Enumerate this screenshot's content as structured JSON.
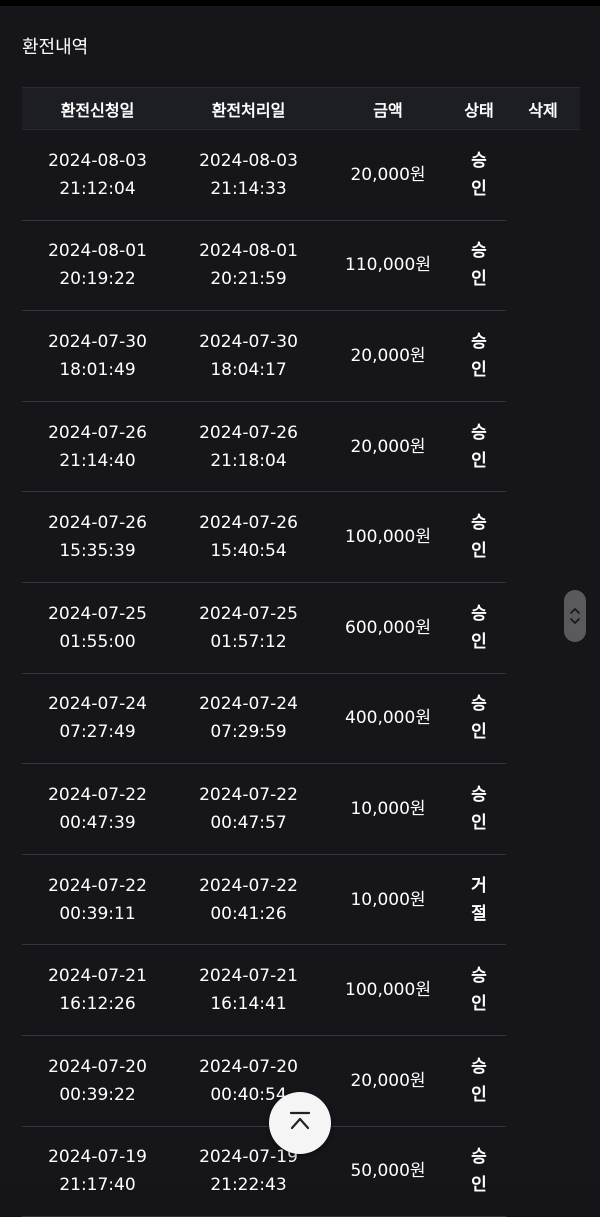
{
  "page": {
    "title": "환전내역"
  },
  "table": {
    "headers": {
      "request_date": "환전신청일",
      "processed_date": "환전처리일",
      "amount": "금액",
      "status": "상태",
      "delete": "삭제"
    },
    "rows": [
      {
        "req_date": "2024-08-03",
        "req_time": "21:12:04",
        "proc_date": "2024-08-03",
        "proc_time": "21:14:33",
        "amount": "20,000원",
        "status_1": "승",
        "status_2": "인"
      },
      {
        "req_date": "2024-08-01",
        "req_time": "20:19:22",
        "proc_date": "2024-08-01",
        "proc_time": "20:21:59",
        "amount": "110,000원",
        "status_1": "승",
        "status_2": "인"
      },
      {
        "req_date": "2024-07-30",
        "req_time": "18:01:49",
        "proc_date": "2024-07-30",
        "proc_time": "18:04:17",
        "amount": "20,000원",
        "status_1": "승",
        "status_2": "인"
      },
      {
        "req_date": "2024-07-26",
        "req_time": "21:14:40",
        "proc_date": "2024-07-26",
        "proc_time": "21:18:04",
        "amount": "20,000원",
        "status_1": "승",
        "status_2": "인"
      },
      {
        "req_date": "2024-07-26",
        "req_time": "15:35:39",
        "proc_date": "2024-07-26",
        "proc_time": "15:40:54",
        "amount": "100,000원",
        "status_1": "승",
        "status_2": "인"
      },
      {
        "req_date": "2024-07-25",
        "req_time": "01:55:00",
        "proc_date": "2024-07-25",
        "proc_time": "01:57:12",
        "amount": "600,000원",
        "status_1": "승",
        "status_2": "인"
      },
      {
        "req_date": "2024-07-24",
        "req_time": "07:27:49",
        "proc_date": "2024-07-24",
        "proc_time": "07:29:59",
        "amount": "400,000원",
        "status_1": "승",
        "status_2": "인"
      },
      {
        "req_date": "2024-07-22",
        "req_time": "00:47:39",
        "proc_date": "2024-07-22",
        "proc_time": "00:47:57",
        "amount": "10,000원",
        "status_1": "승",
        "status_2": "인"
      },
      {
        "req_date": "2024-07-22",
        "req_time": "00:39:11",
        "proc_date": "2024-07-22",
        "proc_time": "00:41:26",
        "amount": "10,000원",
        "status_1": "거",
        "status_2": "절"
      },
      {
        "req_date": "2024-07-21",
        "req_time": "16:12:26",
        "proc_date": "2024-07-21",
        "proc_time": "16:14:41",
        "amount": "100,000원",
        "status_1": "승",
        "status_2": "인"
      },
      {
        "req_date": "2024-07-20",
        "req_time": "00:39:22",
        "proc_date": "2024-07-20",
        "proc_time": "00:40:54",
        "amount": "20,000원",
        "status_1": "승",
        "status_2": "인"
      },
      {
        "req_date": "2024-07-19",
        "req_time": "21:17:40",
        "proc_date": "2024-07-19",
        "proc_time": "21:22:43",
        "amount": "50,000원",
        "status_1": "승",
        "status_2": "인"
      }
    ]
  },
  "scroll_widget": {
    "up_icon": "chevron-up-icon",
    "down_icon": "chevron-down-icon"
  },
  "to_top_button": {
    "icon": "arrow-to-top-icon"
  },
  "colors": {
    "background": "#15151a",
    "header_bg": "#1d1e23",
    "divider": "#34353a",
    "button_bg": "#f5f5f5"
  }
}
